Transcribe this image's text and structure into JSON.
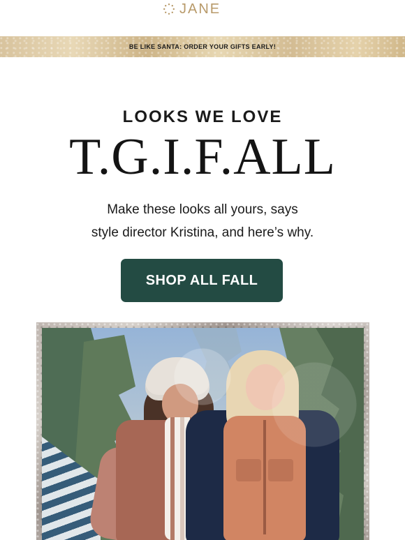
{
  "header": {
    "brand_name": "JANE",
    "logo_icon": "sparkle-ring-icon"
  },
  "banner": {
    "text": "BE LIKE SANTA: ORDER YOUR GIFTS EARLY!"
  },
  "hero": {
    "eyebrow": "LOOKS WE LOVE",
    "headline": "T.G.I.F.ALL",
    "body_line_1": "Make these looks all yours, says",
    "body_line_2": "style director Kristina, and here’s why.",
    "cta_label": "SHOP ALL FALL"
  },
  "colors": {
    "brand_gold": "#b89a6a",
    "cta_green": "#234b43"
  }
}
